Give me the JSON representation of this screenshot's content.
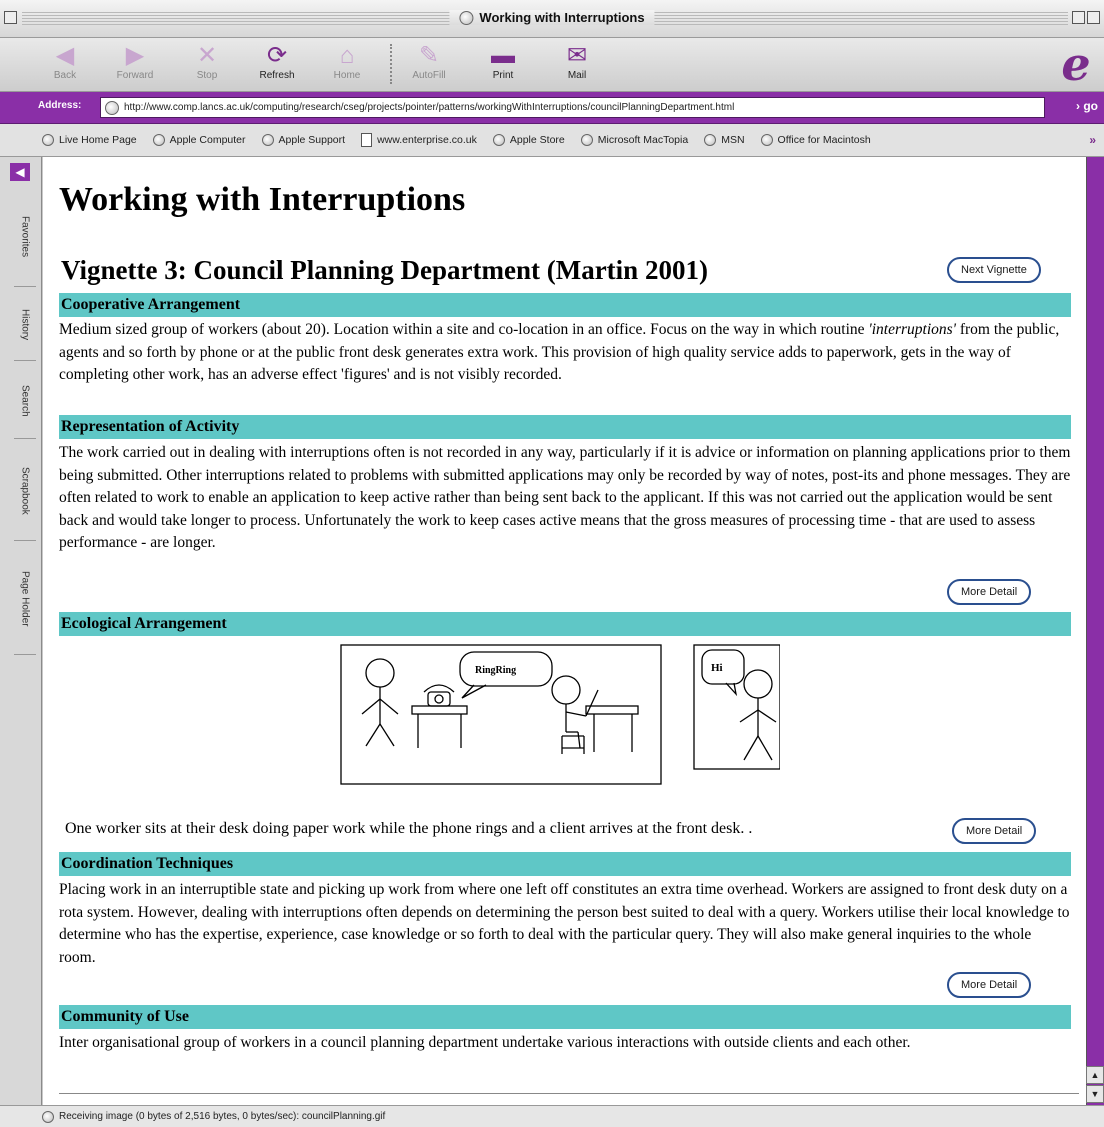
{
  "window": {
    "title": "Working with Interruptions"
  },
  "toolbar": {
    "back": "Back",
    "forward": "Forward",
    "stop": "Stop",
    "refresh": "Refresh",
    "home": "Home",
    "autofill": "AutoFill",
    "print": "Print",
    "mail": "Mail"
  },
  "address": {
    "label": "Address:",
    "url": "http://www.comp.lancs.ac.uk/computing/research/cseg/projects/pointer/patterns/workingWithInterruptions/councilPlanningDepartment.html",
    "go": "go"
  },
  "favorites": {
    "items": [
      "Live Home Page",
      "Apple Computer",
      "Apple Support",
      "www.enterprise.co.uk",
      "Apple Store",
      "Microsoft MacTopia",
      "MSN",
      "Office for Macintosh"
    ],
    "more": "»"
  },
  "sidebar": {
    "tabs": [
      "Favorites",
      "History",
      "Search",
      "Scrapbook",
      "Page Holder"
    ]
  },
  "page": {
    "title": "Working with Interruptions",
    "vignette_title": "Vignette 3: Council Planning Department (Martin 2001)",
    "next_vignette": "Next Vignette",
    "more_detail": "More Detail",
    "sections": {
      "cooperative": {
        "heading": "Cooperative Arrangement",
        "body_start": "Medium sized group of workers (about 20). Location within a site and co-location in an office. Focus on the way in which routine ",
        "body_emph": "'interruptions'",
        "body_end": " from the public, agents and so forth by phone or at the public front desk generates extra work. This provision of high quality service adds to paperwork, gets in the way of completing other work, has an adverse effect 'figures' and is not visibly recorded."
      },
      "representation": {
        "heading": "Representation of Activity",
        "body": "The work carried out in dealing with interruptions often is not recorded in any way, particularly if it is advice or information on planning applications prior to them being submitted. Other interruptions related to problems with submitted applications may only be recorded by way of notes, post-its and phone messages. They are often related to work to enable an application to keep active rather than being sent back to the applicant. If this was not carried out the application would be sent back and would take longer to process. Unfortunately the work to keep cases active means that the gross measures of processing time - that are used to assess performance - are longer."
      },
      "ecological": {
        "heading": "Ecological Arrangement",
        "bubble_phone": "RingRing",
        "bubble_client": "Hi",
        "caption": "One worker sits at their desk doing paper work while the phone rings and a client arrives at the front desk. ."
      },
      "coordination": {
        "heading": "Coordination Techniques",
        "body": "Placing work in an interruptible state and picking up work from where one left off constitutes an extra time overhead. Workers are assigned to front desk duty on a rota system. However, dealing with interruptions often depends on determining the person best suited to deal with a query. Workers utilise their local knowledge to determine who has the expertise, experience, case knowledge or so forth to deal with the particular query. They will also make general inquiries to the whole room."
      },
      "community": {
        "heading": "Community of Use",
        "body": "Inter organisational group of workers in a council planning department undertake various interactions with outside clients and each other."
      }
    }
  },
  "status": {
    "text": "Receiving image (0 bytes of 2,516 bytes, 0 bytes/sec): councilPlanning.gif"
  }
}
